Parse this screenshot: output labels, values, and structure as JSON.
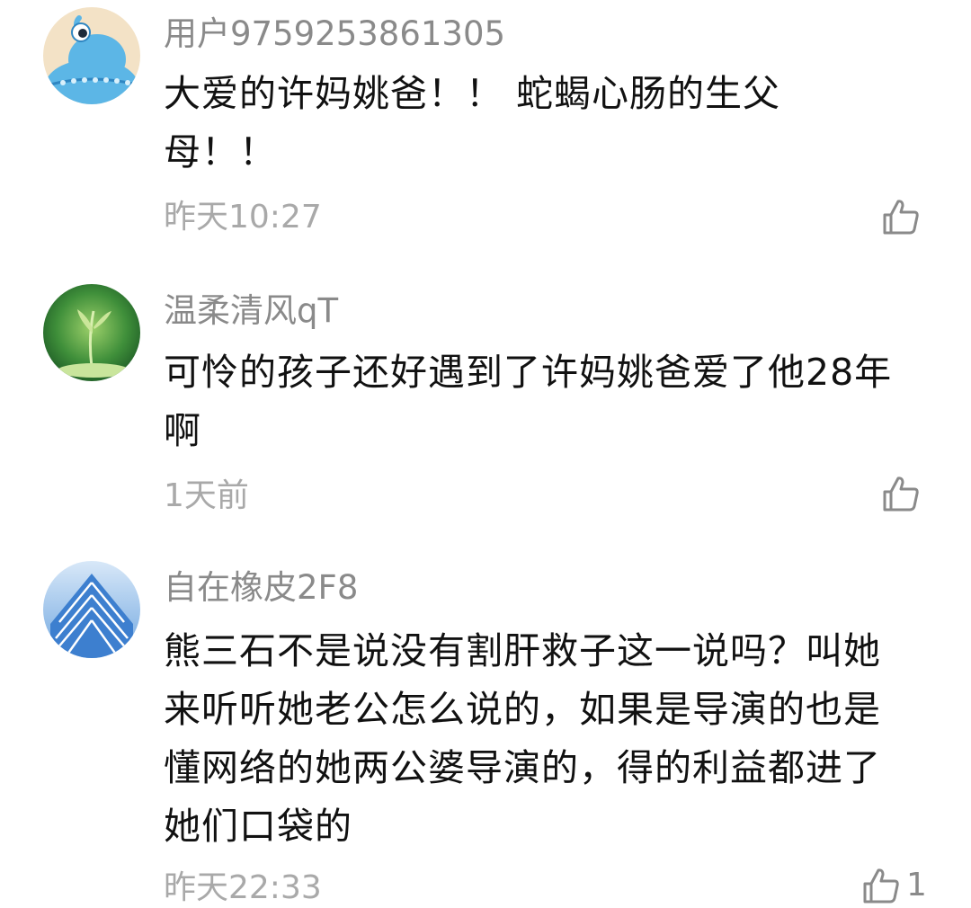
{
  "comments": [
    {
      "username": "用户9759253861305",
      "content": "大爱的许妈姚爸！！ 蛇蝎心肠的生父母！！",
      "time": "昨天10:27",
      "likes": "",
      "avatar_icon": "blue-alien-avatar-icon",
      "colors": {
        "avatar_bg": "#f3e2c6",
        "avatar_fg": "#5cb6e6"
      }
    },
    {
      "username": "温柔清风qT",
      "content": "可怜的孩子还好遇到了许妈姚爸爱了他28年啊",
      "time": "1天前",
      "likes": "",
      "avatar_icon": "green-sprout-avatar-icon",
      "colors": {
        "avatar_bg": "#2f7d32",
        "avatar_fg": "#c9e59c"
      }
    },
    {
      "username": "自在橡皮2F8",
      "content": "熊三石不是说没有割肝救子这一说吗？叫她来听听她老公怎么说的，如果是导演的也是懂网络的她两公婆导演的，得的利益都进了她们口袋的",
      "time": "昨天22:33",
      "likes": "1",
      "avatar_icon": "blue-building-avatar-icon",
      "colors": {
        "avatar_bg": "#7fb2e8",
        "avatar_fg": "#ffffff"
      }
    }
  ],
  "like_icon": "thumbs-up-icon",
  "colors": {
    "username": "#8a8a8a",
    "content": "#111111",
    "time": "#a9a9a9",
    "icon": "#8a8a8a"
  }
}
